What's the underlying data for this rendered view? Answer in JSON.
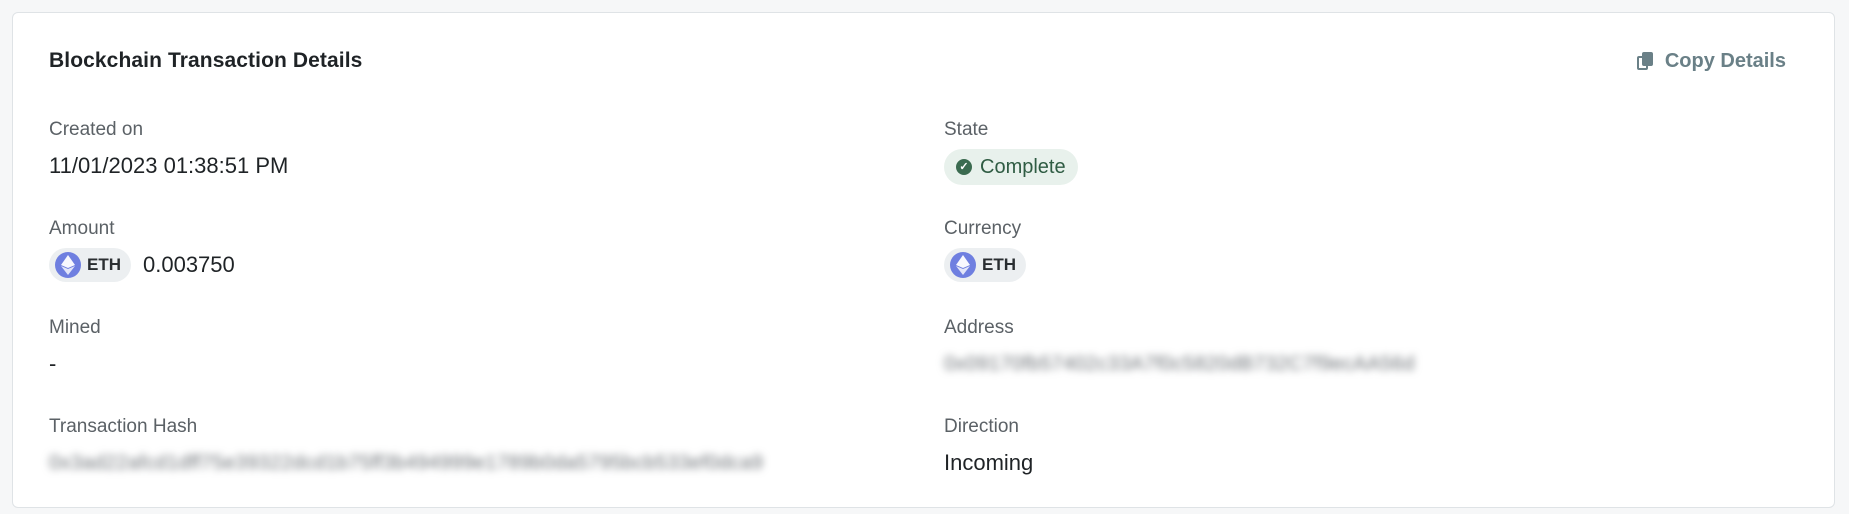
{
  "card": {
    "title": "Blockchain Transaction Details",
    "copy_label": "Copy Details"
  },
  "fields": {
    "created_on": {
      "label": "Created on",
      "value": "11/01/2023 01:38:51 PM"
    },
    "state": {
      "label": "State",
      "value": "Complete",
      "status_color": "#3b6b50",
      "status_bg": "#e8f1ec"
    },
    "amount": {
      "label": "Amount",
      "currency": "ETH",
      "value": "0.003750"
    },
    "currency": {
      "label": "Currency",
      "value": "ETH",
      "icon": "ethereum-icon",
      "icon_color": "#6f7fe0"
    },
    "mined": {
      "label": "Mined",
      "value": "-"
    },
    "address": {
      "label": "Address",
      "value": "0x09170fb57402c33A7f0c5820dB732C7f9ecAA56d"
    },
    "transaction_hash": {
      "label": "Transaction Hash",
      "value": "0x3ad22afcd1dff75e39322dcd1b75ff3b494999e1789b0da5795bcb533ef0dca9"
    },
    "direction": {
      "label": "Direction",
      "value": "Incoming"
    }
  }
}
